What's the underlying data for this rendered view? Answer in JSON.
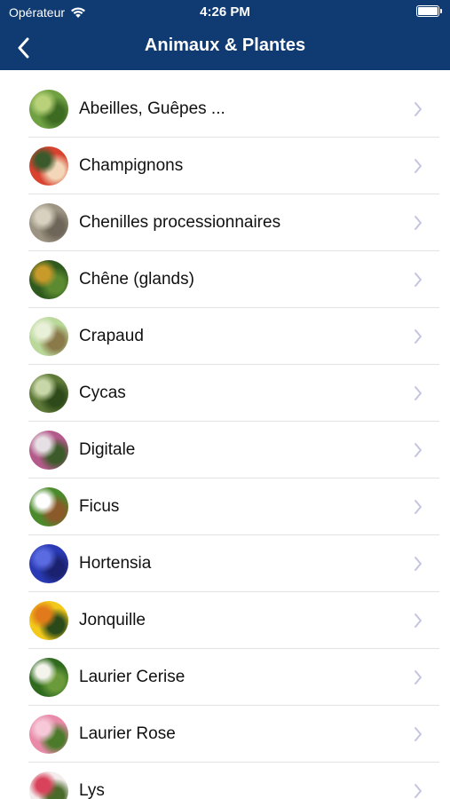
{
  "status_bar": {
    "carrier": "Opérateur",
    "time": "4:26 PM"
  },
  "nav": {
    "title": "Animaux & Plantes",
    "back_icon": "chevron-left-icon"
  },
  "colors": {
    "nav_bg": "#0f3a72",
    "chevron": "#c4c4e0",
    "separator": "#e3e3e6"
  },
  "items": [
    {
      "label": "Abeilles, Guêpes ...",
      "thumb_colors": [
        "#6fa042",
        "#b9d27a",
        "#3e6b22"
      ]
    },
    {
      "label": "Champignons",
      "thumb_colors": [
        "#d8422f",
        "#3a5a2c",
        "#f3d7b8"
      ]
    },
    {
      "label": "Chenilles processionnaires",
      "thumb_colors": [
        "#9c9382",
        "#d8d1c0",
        "#6e6658"
      ]
    },
    {
      "label": "Chêne (glands)",
      "thumb_colors": [
        "#2f5a1e",
        "#c79a2a",
        "#5c8a30"
      ]
    },
    {
      "label": "Crapaud",
      "thumb_colors": [
        "#b9d89a",
        "#e9f0d8",
        "#8a7a4a"
      ]
    },
    {
      "label": "Cycas",
      "thumb_colors": [
        "#5f7a38",
        "#c8d7a8",
        "#2f4a1a"
      ]
    },
    {
      "label": "Digitale",
      "thumb_colors": [
        "#b45a8a",
        "#e6e0e4",
        "#3c5a2a"
      ]
    },
    {
      "label": "Ficus",
      "thumb_colors": [
        "#4a8a2a",
        "#ffffff",
        "#8a5a2a"
      ]
    },
    {
      "label": "Hortensia",
      "thumb_colors": [
        "#2a3ab4",
        "#5a6ae0",
        "#1a2270"
      ]
    },
    {
      "label": "Jonquille",
      "thumb_colors": [
        "#f2c81a",
        "#e07a1a",
        "#2a4a1a"
      ]
    },
    {
      "label": "Laurier Cerise",
      "thumb_colors": [
        "#2f6a1e",
        "#f4f4ec",
        "#6a9a3a"
      ]
    },
    {
      "label": "Laurier Rose",
      "thumb_colors": [
        "#e88aa8",
        "#f6c8d8",
        "#4a7a2a"
      ]
    },
    {
      "label": "Lys",
      "thumb_colors": [
        "#f4ecec",
        "#d8425a",
        "#4a6a2a"
      ]
    }
  ]
}
